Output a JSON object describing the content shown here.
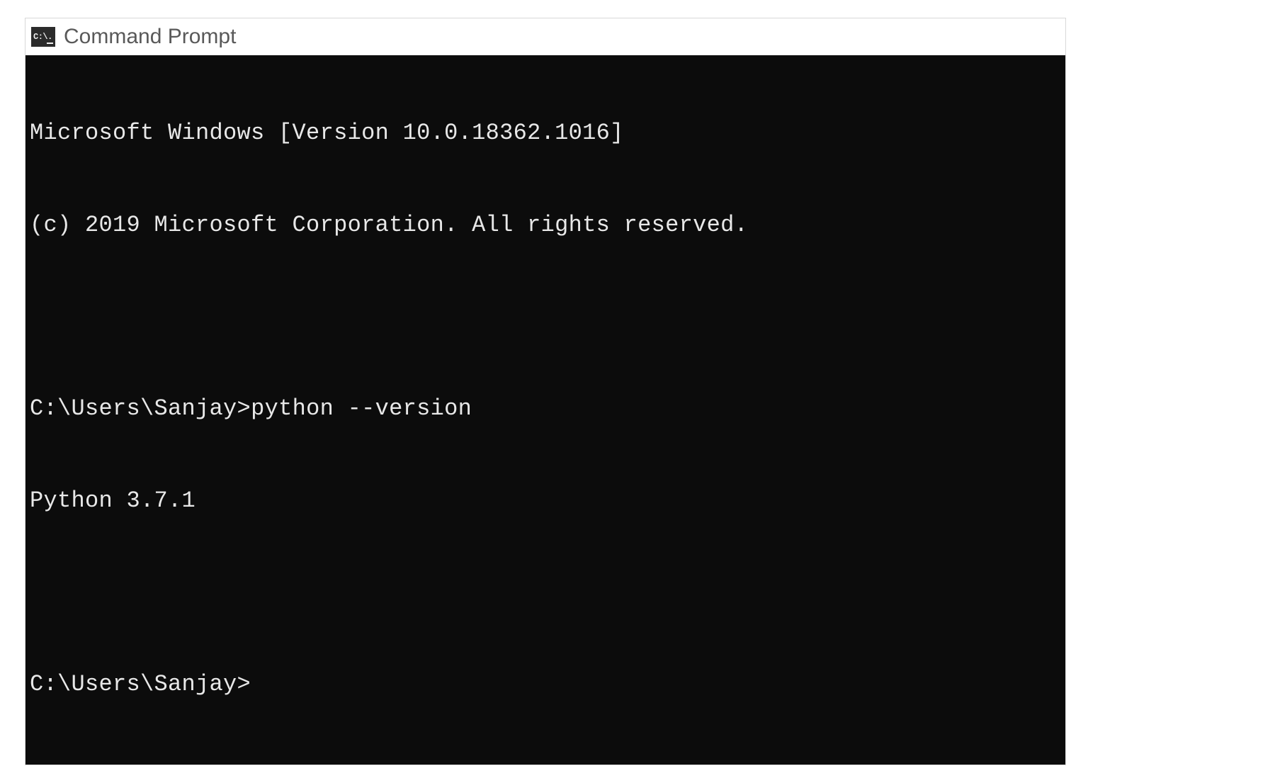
{
  "window": {
    "title": "Command Prompt",
    "icon_text": "C:\\."
  },
  "terminal": {
    "banner_version": "Microsoft Windows [Version 10.0.18362.1016]",
    "banner_copyright": "(c) 2019 Microsoft Corporation. All rights reserved.",
    "history": [
      {
        "prompt": "C:\\Users\\Sanjay>",
        "command": "python --version",
        "output": "Python 3.7.1"
      }
    ],
    "current_prompt": "C:\\Users\\Sanjay>"
  }
}
